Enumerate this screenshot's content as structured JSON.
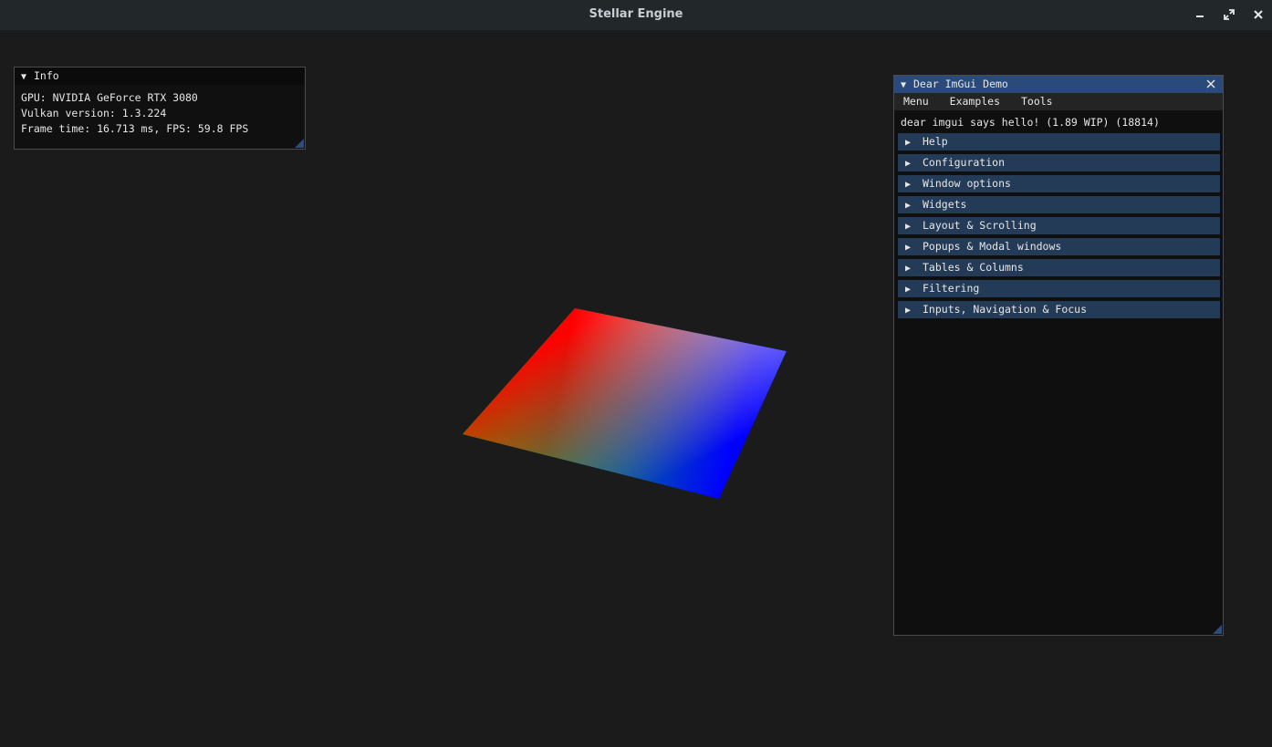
{
  "window": {
    "title": "Stellar Engine",
    "controls": {
      "minimize": "–",
      "maximize": "⤢",
      "close": "✕"
    }
  },
  "scene": {
    "description_colors": {
      "top": "#ff0000",
      "right": "#ffffff",
      "bottom": "#0000ff",
      "left": "#00ff00"
    }
  },
  "info_window": {
    "title": "Info",
    "collapse_icon": "▼",
    "lines": [
      "GPU: NVIDIA GeForce RTX 3080",
      "Vulkan version: 1.3.224",
      "Frame time: 16.713 ms, FPS: 59.8 FPS"
    ]
  },
  "demo_window": {
    "title": "Dear ImGui Demo",
    "collapse_icon": "▼",
    "close_icon": "✕",
    "menu": [
      "Menu",
      "Examples",
      "Tools"
    ],
    "hello_text": "dear imgui says hello! (1.89 WIP) (18814)",
    "section_icon": "▶",
    "sections": [
      "Help",
      "Configuration",
      "Window options",
      "Widgets",
      "Layout & Scrolling",
      "Popups & Modal windows",
      "Tables & Columns",
      "Filtering",
      "Inputs, Navigation & Focus"
    ]
  },
  "colors": {
    "background": "#1b1b1b",
    "titlebar": "#22272a",
    "imgui_title_active": "#294a7a",
    "imgui_header": "#243b58"
  }
}
